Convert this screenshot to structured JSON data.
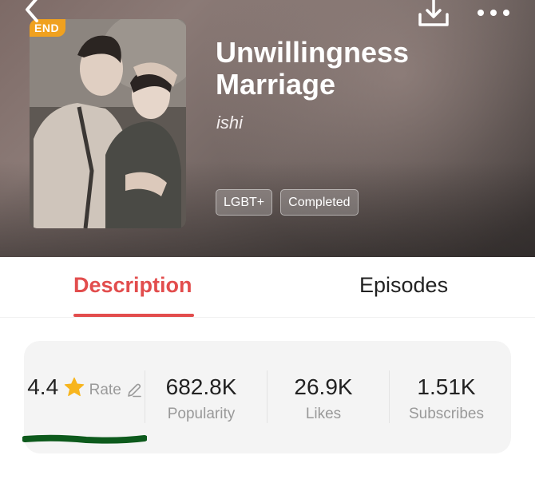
{
  "header": {
    "badge": "END",
    "title": "Unwillingness Marriage",
    "author": "ishi",
    "tags": [
      "LGBT+",
      "Completed"
    ]
  },
  "toolbar": {
    "back_icon": "chevron-left-icon",
    "download_icon": "download-icon",
    "more_icon": "more-dots-icon"
  },
  "tabs": [
    {
      "label": "Description",
      "active": true
    },
    {
      "label": "Episodes",
      "active": false
    }
  ],
  "stats": [
    {
      "value": "4.4",
      "label": "Rate",
      "icon": "star-icon",
      "label_icon": "edit-pencil-icon"
    },
    {
      "value": "682.8K",
      "label": "Popularity"
    },
    {
      "value": "26.9K",
      "label": "Likes"
    },
    {
      "value": "1.51K",
      "label": "Subscribes"
    }
  ],
  "colors": {
    "accent": "#e24d4d",
    "badge": "#f0a11f",
    "star": "#f7b51e",
    "annotation": "#0d5a1c"
  }
}
